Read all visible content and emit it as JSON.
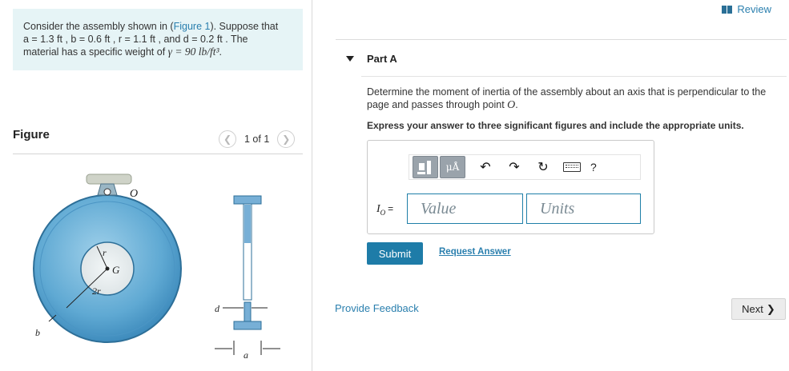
{
  "problem": {
    "text_1": "Consider the assembly shown in (",
    "figure_link": "Figure 1",
    "text_2": "). Suppose that",
    "line2": "a = 1.3  ft , b = 0.6  ft , r = 1.1  ft , and d = 0.2  ft . The",
    "line3_prefix": "material has a specific weight of ",
    "gamma": "γ = 90 lb/ft³",
    "line3_suffix": "."
  },
  "figure": {
    "title": "Figure",
    "pager": "1 of 1",
    "labels": {
      "O": "O",
      "G": "G",
      "r": "r",
      "two_r": "2r",
      "b": "b",
      "d": "d",
      "a": "a"
    }
  },
  "review": {
    "label": "Review"
  },
  "part": {
    "title": "Part A"
  },
  "question": {
    "text": "Determine the moment of inertia of the assembly about an axis that is perpendicular to the page and passes through point ",
    "point": "O",
    "end": "."
  },
  "instruction": "Express your answer to three significant figures and include the appropriate units.",
  "toolbar": {
    "units_button": "μÅ",
    "help": "?"
  },
  "answer": {
    "io_symbol": "I",
    "io_subscript": "O",
    "equals": "=",
    "value_placeholder": "Value",
    "units_placeholder": "Units"
  },
  "actions": {
    "submit": "Submit",
    "request_answer": "Request Answer",
    "feedback": "Provide Feedback",
    "next": "Next",
    "next_chevron": "❯"
  }
}
